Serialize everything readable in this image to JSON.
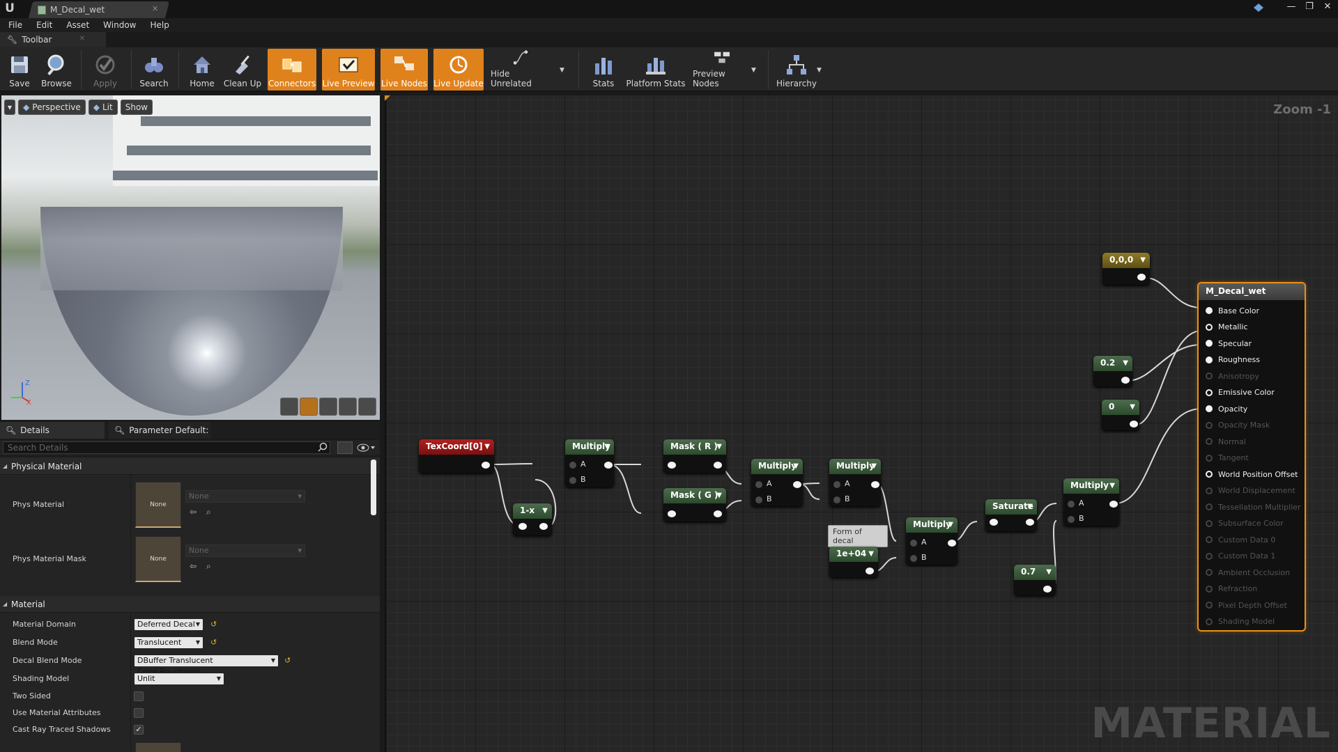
{
  "window": {
    "tab_title": "M_Decal_wet",
    "controls": [
      "—",
      "❐",
      "✕"
    ]
  },
  "menu": [
    "File",
    "Edit",
    "Asset",
    "Window",
    "Help"
  ],
  "toolbar_tab": "Toolbar",
  "toolbar": {
    "save": "Save",
    "browse": "Browse",
    "apply": "Apply",
    "search": "Search",
    "home": "Home",
    "cleanup": "Clean Up",
    "connectors": "Connectors",
    "live_preview": "Live Preview",
    "live_nodes": "Live Nodes",
    "live_update": "Live Update",
    "hide_unrelated": "Hide Unrelated",
    "stats": "Stats",
    "platform_stats": "Platform Stats",
    "preview_nodes": "Preview Nodes",
    "hierarchy": "Hierarchy"
  },
  "viewport": {
    "perspective": "Perspective",
    "lit": "Lit",
    "show": "Show",
    "axis_z": "Z",
    "axis_x": "X"
  },
  "panel_tabs": {
    "details": "Details",
    "params": "Parameter Default:"
  },
  "search": {
    "placeholder": "Search Details"
  },
  "details": {
    "physical_category": "Physical Material",
    "phys_material": "Phys Material",
    "phys_material_mask": "Phys Material Mask",
    "none": "None",
    "material_category": "Material",
    "material_domain": {
      "label": "Material Domain",
      "value": "Deferred Decal"
    },
    "blend_mode": {
      "label": "Blend Mode",
      "value": "Translucent"
    },
    "decal_blend_mode": {
      "label": "Decal Blend Mode",
      "value": "DBuffer Translucent Color,Roughness"
    },
    "shading_model": {
      "label": "Shading Model",
      "value": "Unlit"
    },
    "two_sided": {
      "label": "Two Sided",
      "checked": false
    },
    "use_material_attributes": {
      "label": "Use Material Attributes",
      "checked": false
    },
    "cast_ray_traced_shadows": {
      "label": "Cast Ray Traced Shadows",
      "checked": true,
      "mark": "✓"
    }
  },
  "graph": {
    "zoom": "Zoom -1",
    "watermark": "MATERIAL",
    "nodes": {
      "texcoord": "TexCoord[0]",
      "one_minus": "1-x",
      "multiply": "Multiply",
      "mask_r": "Mask ( R )",
      "mask_g": "Mask ( G )",
      "saturate": "Saturate",
      "const_vec": "0,0,0",
      "const_02": "0.2",
      "const_0": "0",
      "const_07": "0.7",
      "const_1e4": "1e+04",
      "comment": "Form of decal",
      "pin_a": "A",
      "pin_b": "B"
    },
    "result": {
      "title": "M_Decal_wet",
      "pins": [
        {
          "label": "Base Color",
          "state": "on"
        },
        {
          "label": "Metallic",
          "state": "on-ring"
        },
        {
          "label": "Specular",
          "state": "on"
        },
        {
          "label": "Roughness",
          "state": "on"
        },
        {
          "label": "Anisotropy",
          "state": "off"
        },
        {
          "label": "Emissive Color",
          "state": "on-ring"
        },
        {
          "label": "Opacity",
          "state": "on"
        },
        {
          "label": "Opacity Mask",
          "state": "off"
        },
        {
          "label": "Normal",
          "state": "off"
        },
        {
          "label": "Tangent",
          "state": "off"
        },
        {
          "label": "World Position Offset",
          "state": "on-ring"
        },
        {
          "label": "World Displacement",
          "state": "off"
        },
        {
          "label": "Tessellation Multiplier",
          "state": "off"
        },
        {
          "label": "Subsurface Color",
          "state": "off"
        },
        {
          "label": "Custom Data 0",
          "state": "off"
        },
        {
          "label": "Custom Data 1",
          "state": "off"
        },
        {
          "label": "Ambient Occlusion",
          "state": "off"
        },
        {
          "label": "Refraction",
          "state": "off"
        },
        {
          "label": "Pixel Depth Offset",
          "state": "off"
        },
        {
          "label": "Shading Model",
          "state": "off"
        }
      ]
    }
  },
  "colors": {
    "accent": "#e0821c",
    "node_green": "#3c5a3c",
    "node_red": "#9a1818",
    "node_yellow": "#7a6820"
  }
}
